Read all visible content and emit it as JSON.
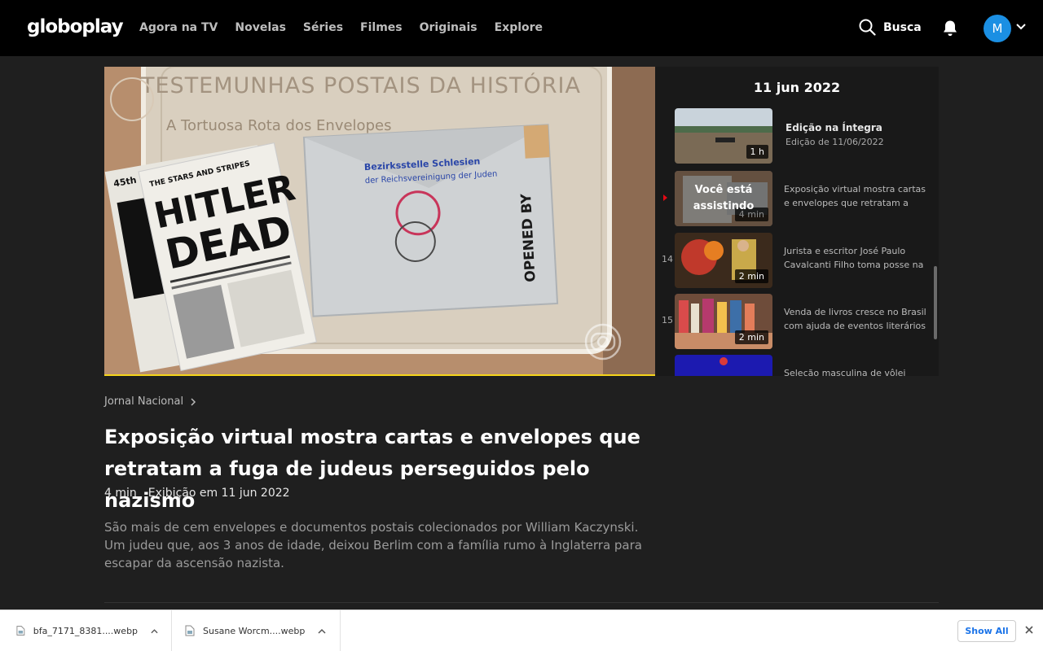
{
  "header": {
    "logo": "globoplay",
    "nav": [
      "Agora na TV",
      "Novelas",
      "Séries",
      "Filmes",
      "Originais",
      "Explore"
    ],
    "search_label": "Busca",
    "avatar_initial": "M",
    "colors": {
      "background": "#000000",
      "avatar": "#1b8fe3"
    }
  },
  "player": {
    "board_title": "TESTEMUNHAS POSTAIS DA HISTÓRIA",
    "board_subtitle": "A Tortuosa Rota dos Envelopes",
    "newspaper_header": "45th Division News",
    "newspaper_masthead": "THE STARS AND STRIPES",
    "headline_line1": "HITLER",
    "headline_line2": "DEAD",
    "envelope_stamp": "OPENED BY",
    "envelope_address_1": "Bezirksstelle Schlesien",
    "envelope_address_2": "der Reichsvereinigung der Juden",
    "progress_percent": 100
  },
  "panel": {
    "date": "11 jun 2022",
    "full_episode": {
      "title": "Edição na Íntegra",
      "subtitle": "Edição de 11/06/2022",
      "duration": "1 h"
    },
    "watching_label_1": "Você está",
    "watching_label_2": "assistindo",
    "items": [
      {
        "number": "",
        "duration": "4 min",
        "description": "Exposição virtual mostra cartas e envelopes que retratam a"
      },
      {
        "number": "14",
        "duration": "2 min",
        "description": "Jurista e escritor José Paulo Cavalcanti Filho toma posse na"
      },
      {
        "number": "15",
        "duration": "2 min",
        "description": "Venda de livros cresce no Brasil com ajuda de eventos literários"
      },
      {
        "number": "",
        "duration": "",
        "description": "Seleção masculina de vôlei"
      }
    ]
  },
  "info": {
    "program": "Jornal Nacional",
    "title": "Exposição virtual mostra cartas e envelopes que retratam a fuga de judeus perseguidos pelo nazismo",
    "duration": "4 min",
    "aired": "Exibição em 11 jun 2022",
    "description": "São mais de cem envelopes e documentos postais colecionados por William Kaczynski. Um judeu que, aos 3 anos de idade, deixou Berlim com a família rumo à Inglaterra para escapar da ascensão nazista."
  },
  "downloads": {
    "files": [
      "bfa_7171_8381....webp",
      "Susane Worcm....webp"
    ],
    "show_all": "Show All"
  }
}
